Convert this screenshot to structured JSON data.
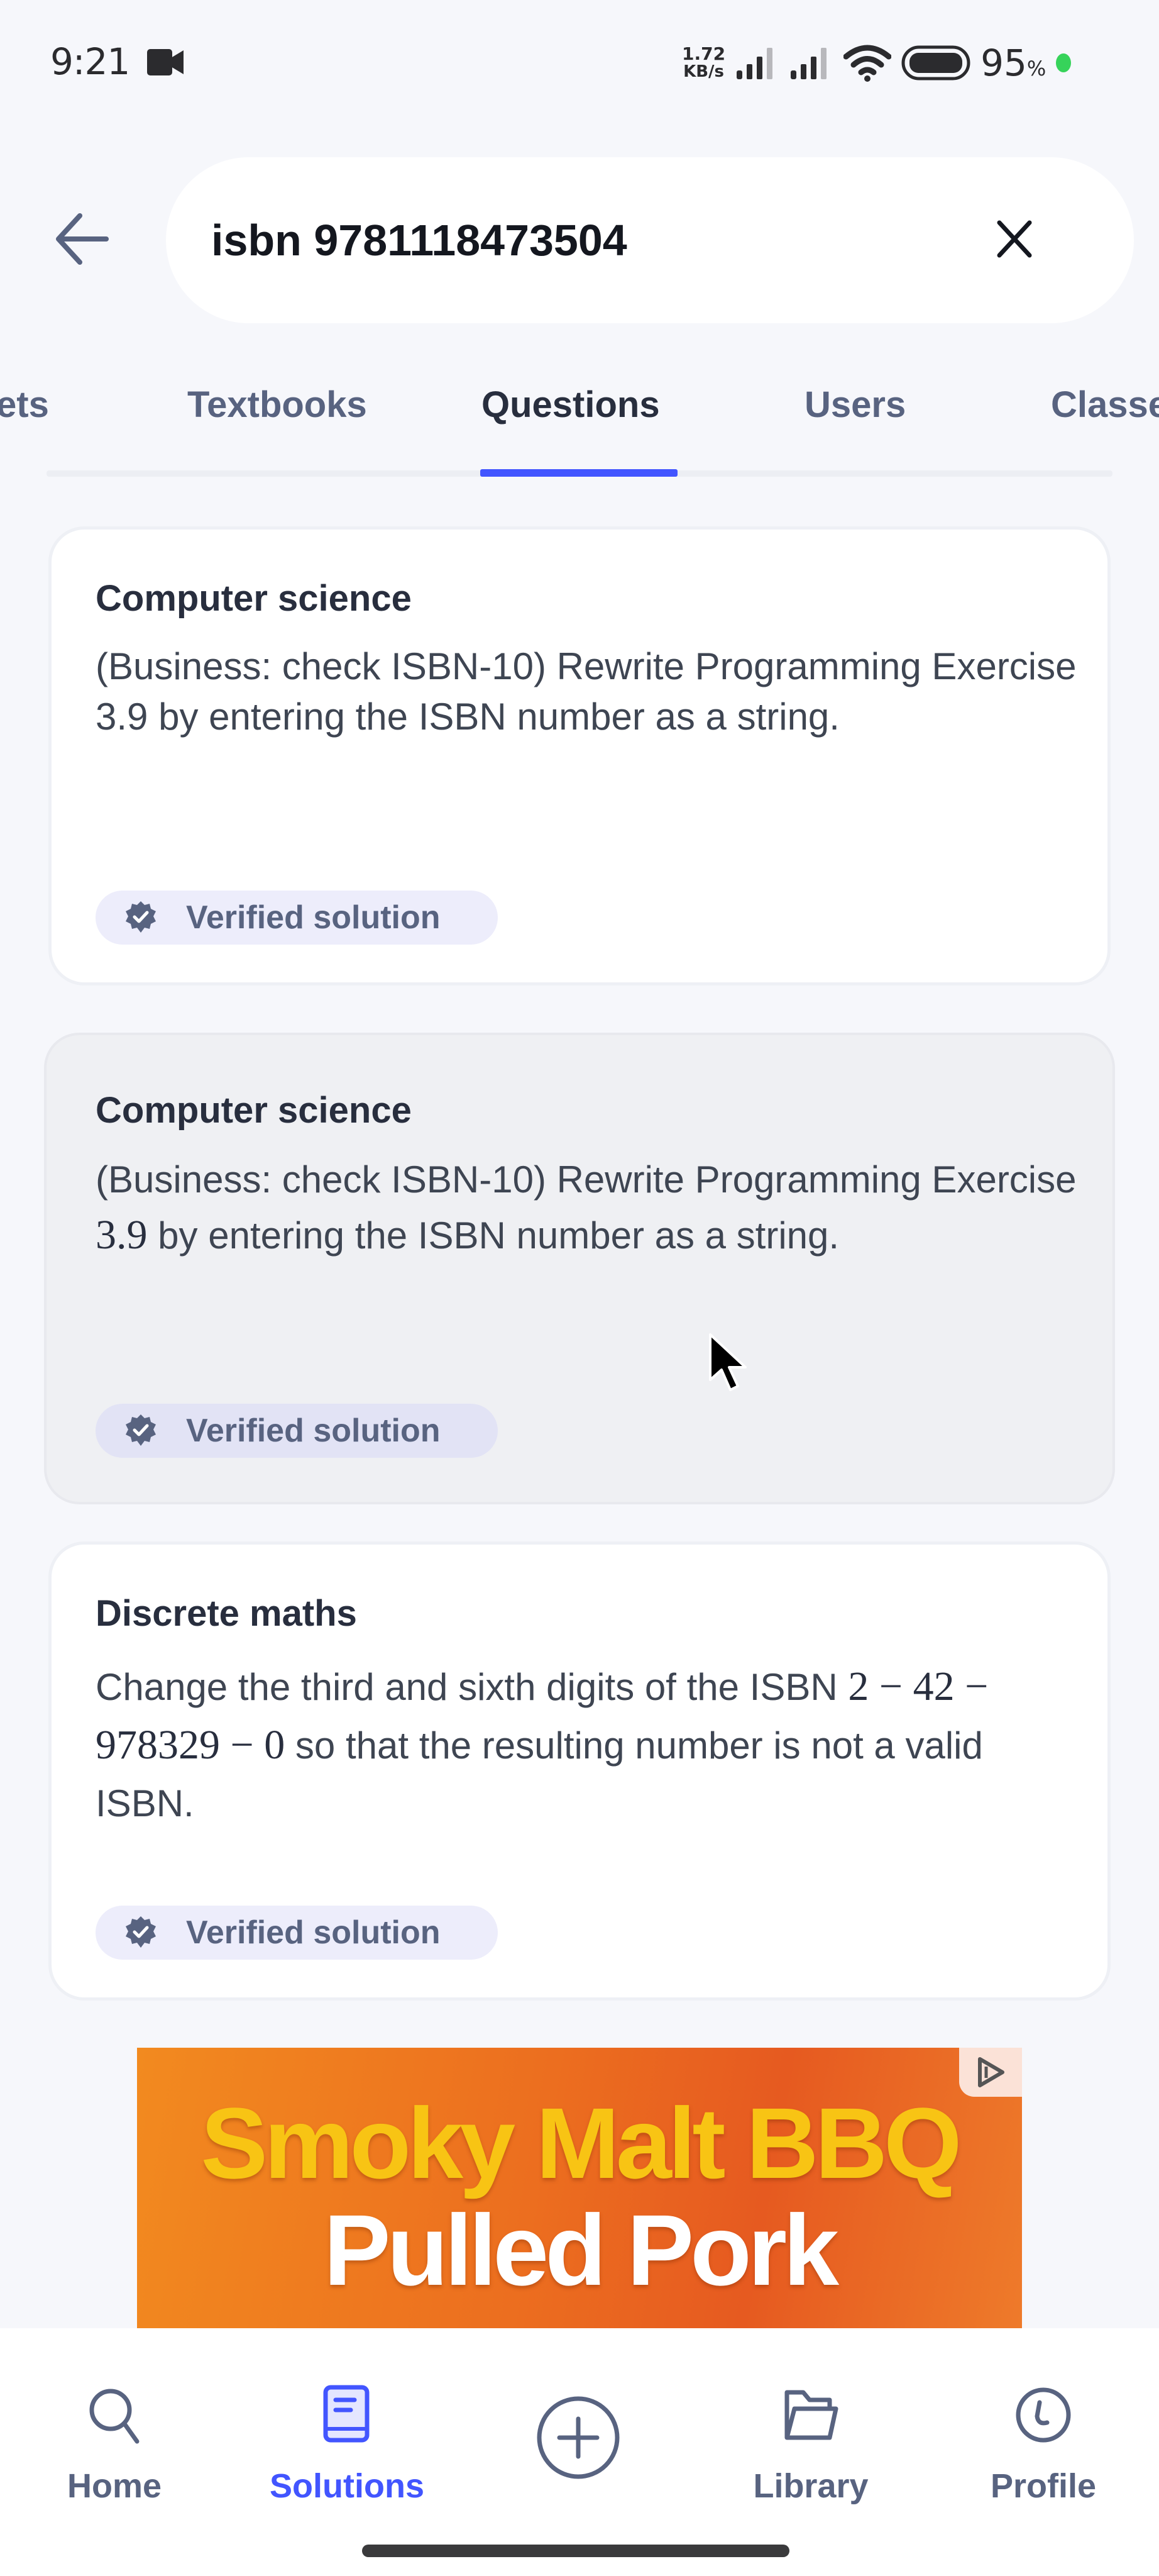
{
  "status_bar": {
    "time": "9:21",
    "net_speed_value": "1.72",
    "net_speed_unit": "KB/s",
    "battery_percent": "95",
    "battery_percent_sign": "%",
    "icons": [
      "video-camera-icon",
      "signal-icon",
      "signal-icon",
      "wifi-icon",
      "battery-icon",
      "charging-dot-icon"
    ]
  },
  "search": {
    "query": "isbn 9781118473504",
    "back_icon": "arrow-left-icon",
    "clear_icon": "close-icon"
  },
  "tabs": [
    {
      "label": "ets",
      "full_label": "Flashcard sets",
      "active": false
    },
    {
      "label": "Textbooks",
      "active": false
    },
    {
      "label": "Questions",
      "active": true
    },
    {
      "label": "Users",
      "active": false
    },
    {
      "label": "Classe",
      "full_label": "Classes",
      "active": false
    }
  ],
  "accent_color": "#4255ff",
  "results": [
    {
      "subject": "Computer science",
      "body_parts": [
        {
          "type": "text",
          "value": "(Business: check ISBN-10) Rewrite Programming Exercise 3.9 by entering the ISBN number as a string."
        }
      ],
      "badge": "Verified solution",
      "state": "default"
    },
    {
      "subject": "Computer science",
      "body_parts": [
        {
          "type": "text",
          "value": "(Business: check ISBN-10) Rewrite Programming Exercise "
        },
        {
          "type": "math",
          "value": "3.9"
        },
        {
          "type": "text",
          "value": " by entering the ISBN number as a string."
        }
      ],
      "badge": "Verified solution",
      "state": "pressed"
    },
    {
      "subject": "Discrete maths",
      "body_parts": [
        {
          "type": "text",
          "value": "Change the third and sixth digits of the ISBN "
        },
        {
          "type": "math",
          "value": "2 − 42 − 978329 − 0"
        },
        {
          "type": "text",
          "value": " so that the resulting number is not a valid ISBN."
        }
      ],
      "badge": "Verified solution",
      "state": "default"
    }
  ],
  "ad": {
    "line1": "Smoky Malt BBQ",
    "line2": "Pulled Pork",
    "adchoices_icon": "ad-choices-icon"
  },
  "bottom_nav": {
    "items": [
      {
        "label": "Home",
        "icon": "search-icon",
        "active": false
      },
      {
        "label": "Solutions",
        "icon": "book-icon",
        "active": true
      },
      {
        "label": "",
        "icon": "plus-circle-icon",
        "active": false
      },
      {
        "label": "Library",
        "icon": "folder-icon",
        "active": false
      },
      {
        "label": "Profile",
        "icon": "profile-icon",
        "active": false
      }
    ]
  }
}
